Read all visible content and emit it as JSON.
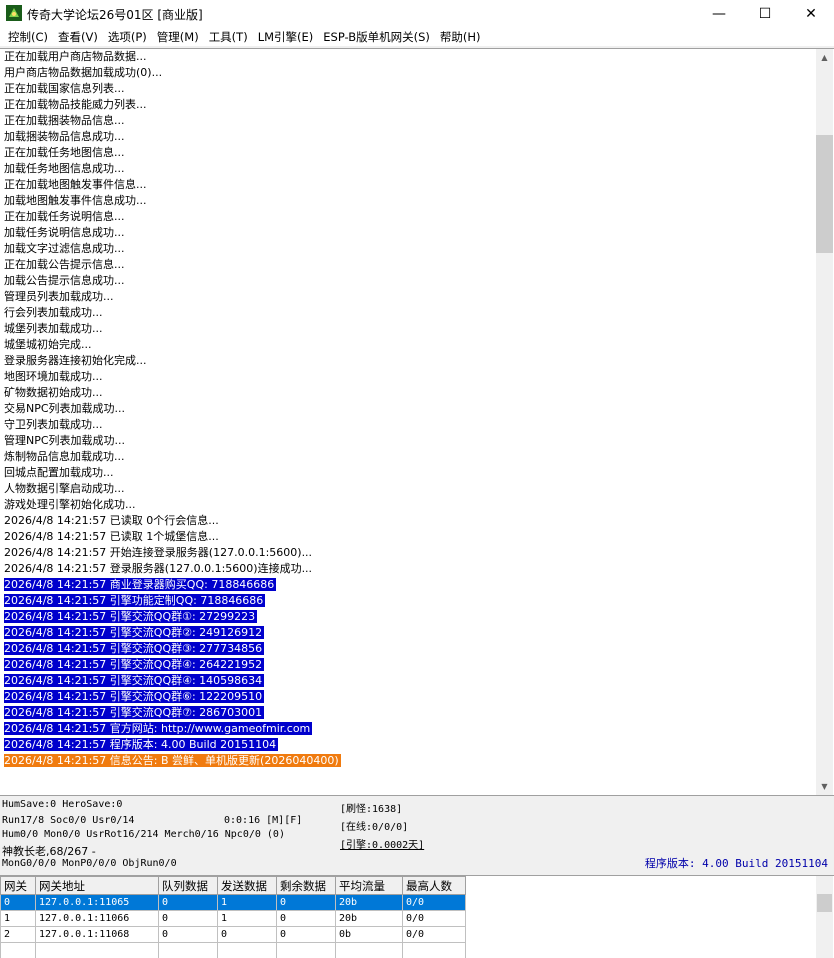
{
  "window": {
    "title": "传奇大学论坛26号01区 [商业版]",
    "minimize_glyph": "—",
    "maximize_glyph": "☐",
    "close_glyph": "✕"
  },
  "menu": [
    "控制(C)",
    "查看(V)",
    "选项(P)",
    "管理(M)",
    "工具(T)",
    "LM引擎(E)",
    "ESP-B版单机网关(S)",
    "帮助(H)"
  ],
  "log": [
    {
      "text": "正在加载用户商店物品数据...",
      "style": ""
    },
    {
      "text": "用户商店物品数据加载成功(0)...",
      "style": ""
    },
    {
      "text": "正在加载国家信息列表...",
      "style": ""
    },
    {
      "text": "正在加载物品技能威力列表...",
      "style": ""
    },
    {
      "text": "正在加载捆装物品信息...",
      "style": ""
    },
    {
      "text": "加载捆装物品信息成功...",
      "style": ""
    },
    {
      "text": "正在加载任务地图信息...",
      "style": ""
    },
    {
      "text": "加载任务地图信息成功...",
      "style": ""
    },
    {
      "text": "正在加载地图触发事件信息...",
      "style": ""
    },
    {
      "text": "加载地图触发事件信息成功...",
      "style": ""
    },
    {
      "text": "正在加载任务说明信息...",
      "style": ""
    },
    {
      "text": "加载任务说明信息成功...",
      "style": ""
    },
    {
      "text": "加载文字过滤信息成功...",
      "style": ""
    },
    {
      "text": "正在加载公告提示信息...",
      "style": ""
    },
    {
      "text": "加载公告提示信息成功...",
      "style": ""
    },
    {
      "text": "管理员列表加载成功...",
      "style": ""
    },
    {
      "text": "行会列表加载成功...",
      "style": ""
    },
    {
      "text": "城堡列表加载成功...",
      "style": ""
    },
    {
      "text": "城堡城初始完成...",
      "style": ""
    },
    {
      "text": "登录服务器连接初始化完成...",
      "style": ""
    },
    {
      "text": "地图环境加载成功...",
      "style": ""
    },
    {
      "text": "矿物数据初始成功...",
      "style": ""
    },
    {
      "text": "交易NPC列表加载成功...",
      "style": ""
    },
    {
      "text": "守卫列表加载成功...",
      "style": ""
    },
    {
      "text": "管理NPC列表加载成功...",
      "style": ""
    },
    {
      "text": "炼制物品信息加载成功...",
      "style": ""
    },
    {
      "text": "回城点配置加载成功...",
      "style": ""
    },
    {
      "text": "人物数据引擎启动成功...",
      "style": ""
    },
    {
      "text": "游戏处理引擎初始化成功...",
      "style": ""
    },
    {
      "text": "2026/4/8 14:21:57 已读取 0个行会信息...",
      "style": ""
    },
    {
      "text": "2026/4/8 14:21:57 已读取 1个城堡信息...",
      "style": ""
    },
    {
      "text": "2026/4/8 14:21:57 开始连接登录服务器(127.0.0.1:5600)...",
      "style": ""
    },
    {
      "text": "2026/4/8 14:21:57 登录服务器(127.0.0.1:5600)连接成功...",
      "style": ""
    },
    {
      "text": "2026/4/8 14:21:57 商业登录器购买QQ: 718846686",
      "style": "hl"
    },
    {
      "text": "2026/4/8 14:21:57 引擎功能定制QQ: 718846686",
      "style": "hl"
    },
    {
      "text": "2026/4/8 14:21:57 引擎交流QQ群①: 27299223",
      "style": "hl"
    },
    {
      "text": "2026/4/8 14:21:57 引擎交流QQ群②: 249126912",
      "style": "hl"
    },
    {
      "text": "2026/4/8 14:21:57 引擎交流QQ群③: 277734856",
      "style": "hl"
    },
    {
      "text": "2026/4/8 14:21:57 引擎交流QQ群④: 264221952",
      "style": "hl"
    },
    {
      "text": "2026/4/8 14:21:57 引擎交流QQ群④: 140598634",
      "style": "hl"
    },
    {
      "text": "2026/4/8 14:21:57 引擎交流QQ群⑥: 122209510",
      "style": "hl"
    },
    {
      "text": "2026/4/8 14:21:57 引擎交流QQ群⑦: 286703001",
      "style": "hl"
    },
    {
      "text": "2026/4/8 14:21:57 官方网站: http://www.gameofmir.com",
      "style": "hl"
    },
    {
      "text": "2026/4/8 14:21:57 程序版本: 4.00 Build 20151104",
      "style": "hl"
    },
    {
      "text": "2026/4/8 14:21:57 信息公告: B 尝鲜、单机版更新(2026040400)",
      "style": "or"
    }
  ],
  "status": {
    "line1": "HumSave:0 HeroSave:0",
    "line2a": "Run17/8 Soc0/0 Usr0/14",
    "line2b": "0:0:16 [M][F]",
    "line3": "Hum0/0 Mon0/0 UsrRot16/214 Merch0/16 Npc0/0 (0)",
    "line4": "神教长老,68/267 -",
    "line5": "MonG0/0/0 MonP0/0/0 ObjRun0/0",
    "refresh": "[刷怪:1638]",
    "online": "[在线:0/0/0]",
    "engine": "[引擎:0.0002天]",
    "version": "程序版本: 4.00 Build 20151104"
  },
  "gateways": {
    "headers": [
      "网关",
      "网关地址",
      "队列数据",
      "发送数据",
      "剩余数据",
      "平均流量",
      "最高人数"
    ],
    "rows": [
      [
        "0",
        "127.0.0.1:11065",
        "0",
        "1",
        "0",
        "20b",
        "0/0"
      ],
      [
        "1",
        "127.0.0.1:11066",
        "0",
        "1",
        "0",
        "20b",
        "0/0"
      ],
      [
        "2",
        "127.0.0.1:11068",
        "0",
        "0",
        "0",
        "0b",
        "0/0"
      ]
    ]
  }
}
